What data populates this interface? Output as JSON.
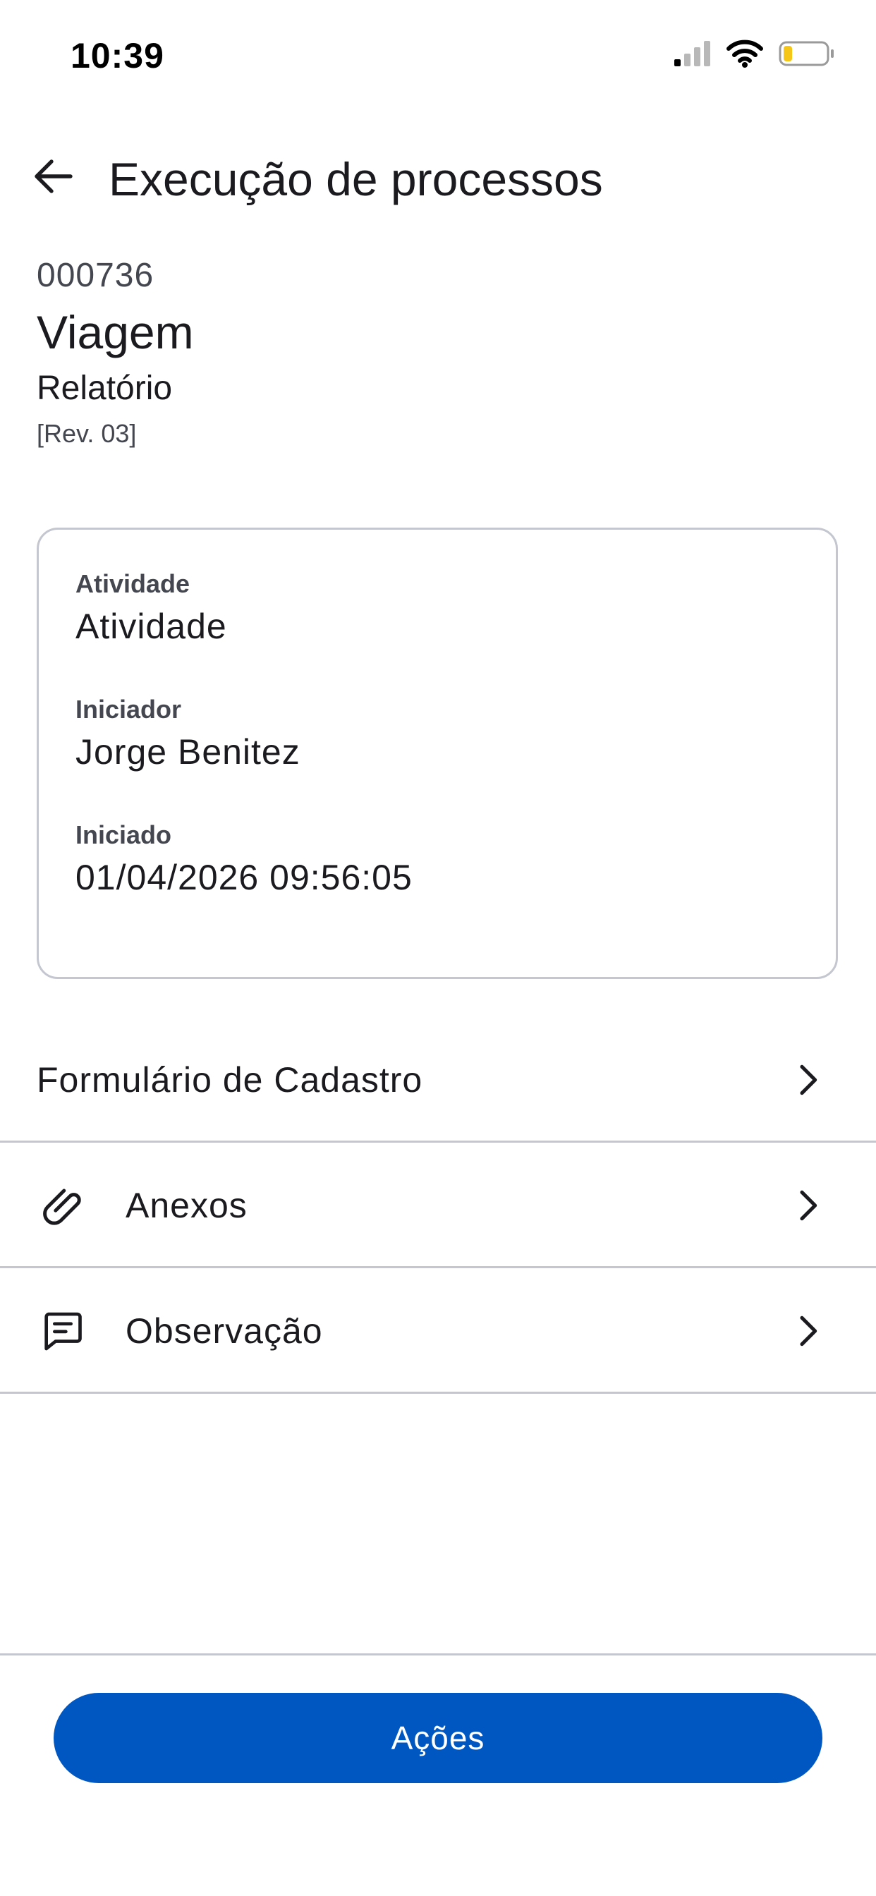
{
  "status_bar": {
    "time": "10:39",
    "icons": [
      "cellular-signal-icon",
      "wifi-icon",
      "battery-icon"
    ],
    "battery_level": 0.2
  },
  "app_bar": {
    "back_icon": "arrow-left-icon",
    "title": "Execução de processos"
  },
  "process": {
    "code": "000736",
    "name": "Viagem",
    "type": "Relatório",
    "revision": "[Rev. 03]"
  },
  "details": {
    "activity_label": "Atividade",
    "activity_value": "Atividade",
    "initiator_label": "Iniciador",
    "initiator_value": "Jorge Benitez",
    "started_label": "Iniciado",
    "started_value": "01/04/2026 09:56:05"
  },
  "menu": {
    "items": [
      {
        "label": "Formulário de Cadastro",
        "icon": "",
        "chevron": "chevron-right-icon"
      },
      {
        "label": "Anexos",
        "icon": "paperclip-icon",
        "chevron": "chevron-right-icon"
      },
      {
        "label": "Observação",
        "icon": "comment-icon",
        "chevron": "chevron-right-icon"
      }
    ]
  },
  "footer": {
    "actions_label": "Ações"
  },
  "colors": {
    "primary": "#0057c2",
    "text": "#1b1b1f",
    "secondary_text": "#44474f",
    "outline": "#c4c6d0",
    "battery": "#f5c518"
  }
}
